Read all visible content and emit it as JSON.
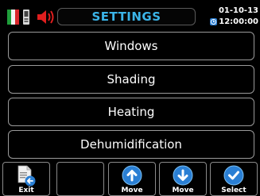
{
  "header": {
    "title": "SETTINGS",
    "date": "01-10-13",
    "time": "12:00:00"
  },
  "colors": {
    "title": "#3bb4e8",
    "icon_accent": "#2a7fd4",
    "flag": [
      "#1e9e3a",
      "#f2f2f2",
      "#d8262b"
    ]
  },
  "icons": {
    "flag": "italian-flag-icon",
    "device": "phone-device-icon",
    "speaker": "speaker-icon",
    "clock": "clock-icon"
  },
  "menu": {
    "items": [
      {
        "label": "Windows"
      },
      {
        "label": "Shading"
      },
      {
        "label": "Heating"
      },
      {
        "label": "Dehumidification"
      }
    ]
  },
  "toolbar": {
    "exit_label": "Exit",
    "move_up_label": "Move",
    "move_down_label": "Move",
    "select_label": "Select"
  }
}
